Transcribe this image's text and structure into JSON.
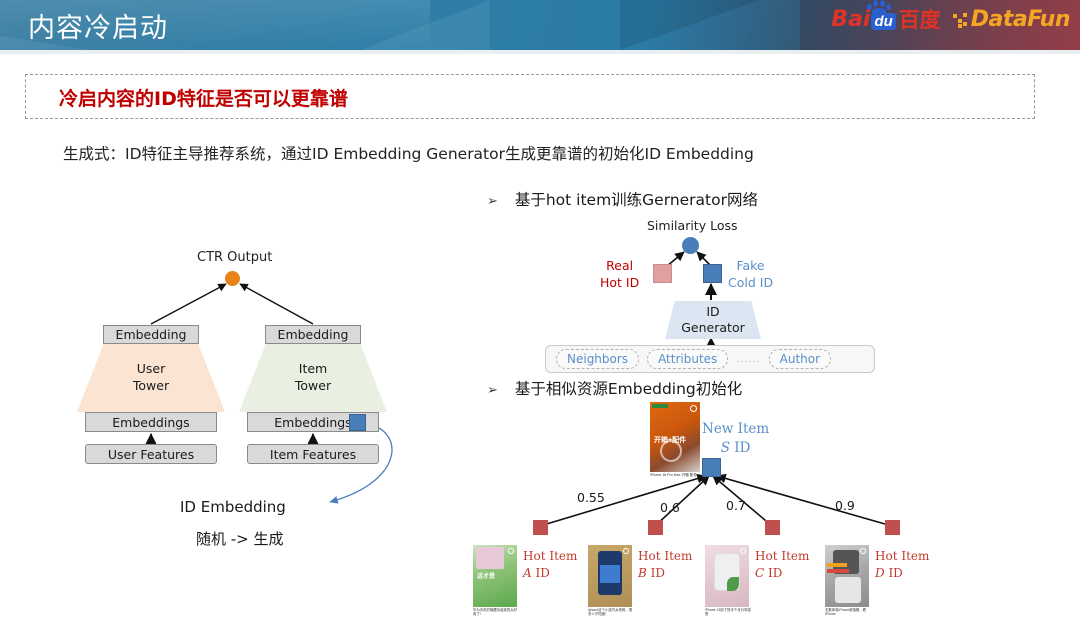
{
  "header": {
    "title": "内容冷启动",
    "logos": {
      "baidu_latin": "Bai",
      "baidu_du": "du",
      "baidu_cn": "百度",
      "datafun": "DataFun"
    }
  },
  "callout": {
    "text": "冷启内容的ID特征是否可以更靠谱"
  },
  "subtitle": "生成式：ID特征主导推荐系统，通过ID Embedding Generator生成更靠谱的初始化ID Embedding",
  "left_diagram": {
    "ctr_output": "CTR Output",
    "embedding_left": "Embedding",
    "embedding_right": "Embedding",
    "user_tower": "User\nTower",
    "user_tower_line1": "User",
    "user_tower_line2": "Tower",
    "item_tower_line1": "Item",
    "item_tower_line2": "Tower",
    "embeddings_left": "Embeddings",
    "embeddings_right": "Embeddings",
    "user_features": "User Features",
    "item_features": "Item Features",
    "id_embedding_label": "ID Embedding",
    "id_embedding_note": "随机 -> 生成",
    "colors": {
      "ctr_dot": "#e8821a",
      "user_tower": "#fbe5d2",
      "item_tower": "#e9efe1",
      "box_fill": "#d9d9d9",
      "blue_square": "#4a7ebb",
      "curve_arrow": "#4a7ebb"
    }
  },
  "right_panel": {
    "bullet_marker": "➢",
    "bullet1": "基于hot item训练Gernerator网络",
    "bullet2": "基于相似资源Embedding初始化",
    "generator": {
      "similarity_loss": "Similarity Loss",
      "real_hot_line1": "Real",
      "real_hot_line2": "Hot ID",
      "fake_cold_line1": "Fake",
      "fake_cold_line2": "Cold ID",
      "id_generator_line1": "ID",
      "id_generator_line2": "Generator",
      "features": [
        "Neighbors",
        "Attributes",
        "Author"
      ],
      "features_ellipsis": "......",
      "colors": {
        "loss_node": "#4a7ebb",
        "real_hot": "#c00000",
        "real_hot_square": "#e0a0a0",
        "fake_cold": "#5b8fc9",
        "fake_cold_square": "#4a7ebb",
        "generator_fill": "#dce6f3",
        "pill_text": "#5b8fc9"
      }
    },
    "similarity": {
      "new_item_line1": "New Item",
      "new_item_id_italic": "S",
      "new_item_id_rest": " ID",
      "new_item_caption": "iPhone 16 Pro Max 开箱\n配件",
      "scores": [
        "0.55",
        "0.6",
        "0.7",
        "0.9"
      ],
      "hot_items": [
        {
          "label": "Hot Item",
          "id_italic": "A",
          "id_rest": " ID",
          "caption": "华为手机的隐藏功能真的太好用了!"
        },
        {
          "label": "Hot Item",
          "id_italic": "B",
          "id_rest": " ID",
          "caption": "iphone这个小技巧太惊艳，很多人不知道！"
        },
        {
          "label": "Hot Item",
          "id_italic": "C",
          "id_rest": " ID",
          "caption": "iPhone 13用了快半个月分享感受"
        },
        {
          "label": "Hot Item",
          "id_italic": "D",
          "id_rest": " ID",
          "caption": "无数体验iPhone新旗舰，看iPhone"
        }
      ],
      "colors": {
        "new_item_text": "#5b8fc9",
        "new_item_square": "#4a7ebb",
        "hot_item_text": "#c0392b",
        "hot_item_square": "#c0504d"
      }
    }
  }
}
